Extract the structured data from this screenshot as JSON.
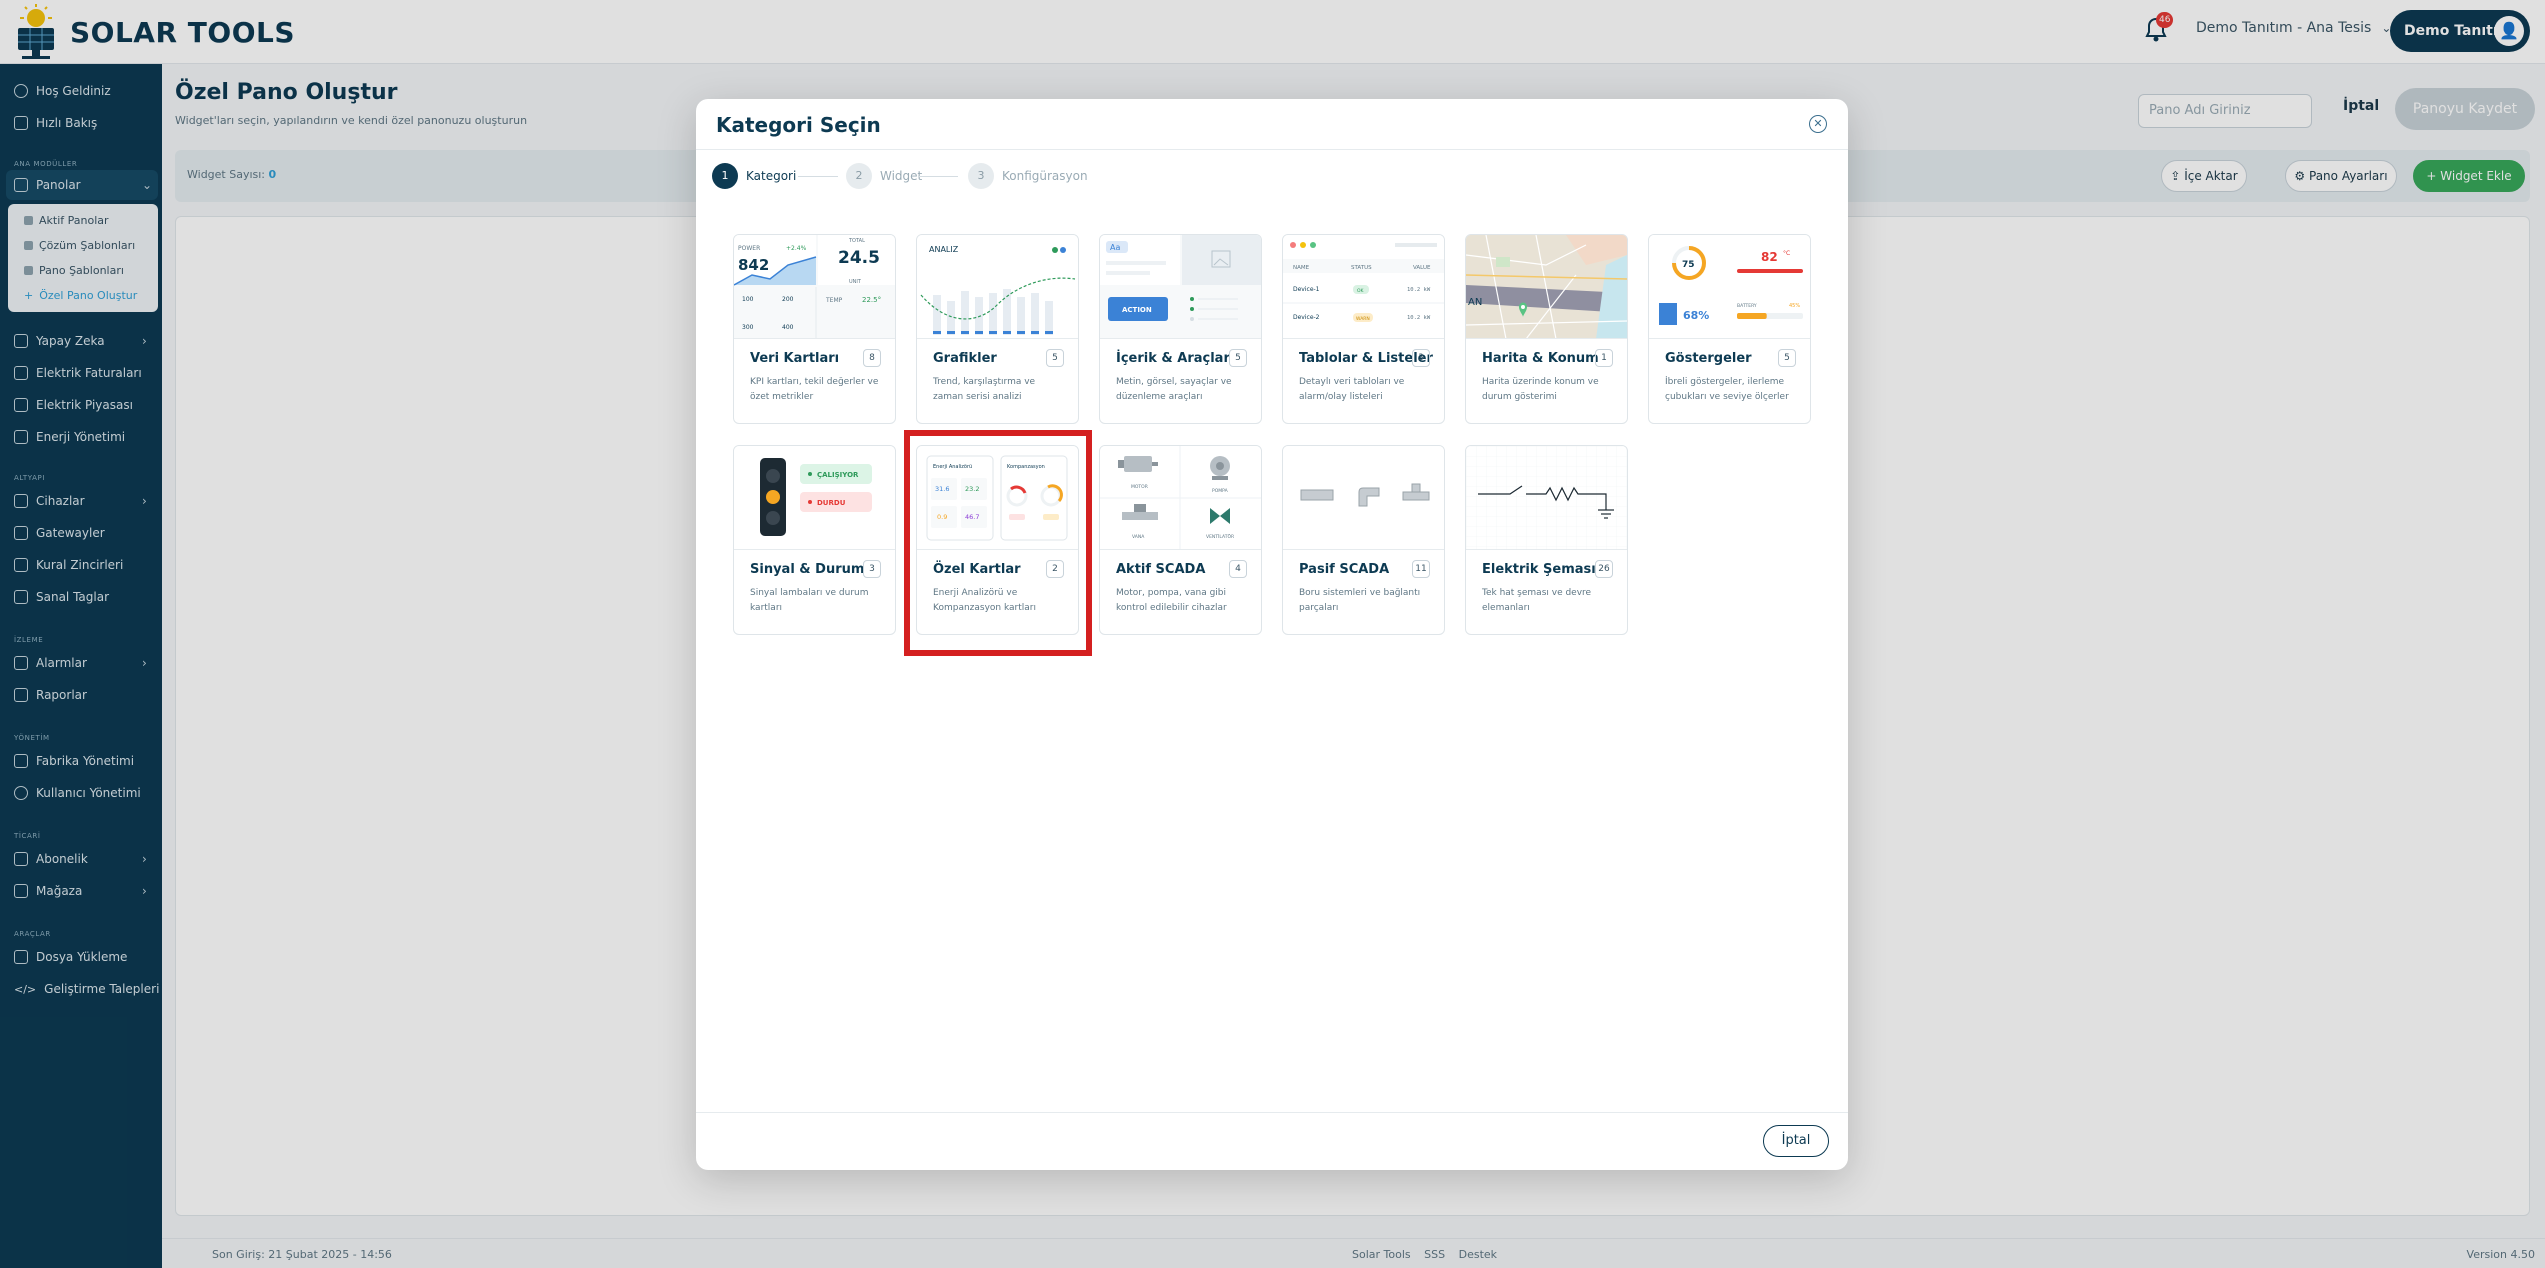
{
  "header": {
    "brand": "SOLAR TOOLS",
    "notification_count": "46",
    "facility": "Demo Tanıtım - Ana Tesis",
    "user": "Demo Tanıtım"
  },
  "sidebar": {
    "top_items": [
      "Hoş Geldiniz",
      "Hızlı Bakış"
    ],
    "section_main": "ANA MODÜLLER",
    "panolar": "Panolar",
    "panolar_sub": [
      "Aktif Panolar",
      "Çözüm Şablonları",
      "Pano Şablonları",
      "Özel Pano Oluştur"
    ],
    "main_items": [
      "Yapay Zeka",
      "Elektrik Faturaları",
      "Elektrik Piyasası",
      "Enerji Yönetimi"
    ],
    "section_infra": "ALTYAPI",
    "infra_items": [
      "Cihazlar",
      "Gatewayler",
      "Kural Zincirleri",
      "Sanal Taglar"
    ],
    "section_monitor": "İZLEME",
    "monitor_items": [
      "Alarmlar",
      "Raporlar"
    ],
    "section_admin": "YÖNETİM",
    "admin_items": [
      "Fabrika Yönetimi",
      "Kullanıcı Yönetimi"
    ],
    "section_commerce": "TİCARİ",
    "commerce_items": [
      "Abonelik",
      "Mağaza"
    ],
    "section_tools": "ARAÇLAR",
    "tools_items": [
      "Dosya Yükleme",
      "Geliştirme Talepleri"
    ]
  },
  "page": {
    "title": "Özel Pano Oluştur",
    "subtitle": "Widget'ları seçin, yapılandırın ve kendi özel panonuzu oluşturun",
    "name_placeholder": "Pano Adı Giriniz",
    "cancel": "İptal",
    "save": "Panoyu Kaydet",
    "widget_count_label": "Widget Sayısı:",
    "widget_count": "0",
    "import": "İçe Aktar",
    "settings": "Pano Ayarları",
    "add_widget": "Widget Ekle"
  },
  "footer": {
    "last_login": "Son Giriş: 21 Şubat 2025 - 14:56",
    "links": [
      "Solar Tools",
      "SSS",
      "Destek"
    ],
    "version": "Version 4.50"
  },
  "modal": {
    "title": "Kategori Seçin",
    "steps": [
      "Kategori",
      "Widget",
      "Konfigürasyon"
    ],
    "cancel": "İptal",
    "cards": [
      {
        "name": "Veri Kartları",
        "count": "8",
        "desc": "KPI kartları, tekil değerler ve özet metrikler"
      },
      {
        "name": "Grafikler",
        "count": "5",
        "desc": "Trend, karşılaştırma ve zaman serisi analizi"
      },
      {
        "name": "İçerik & Araçlar",
        "count": "5",
        "desc": "Metin, görsel, sayaçlar ve düzenleme araçları"
      },
      {
        "name": "Tablolar & Listeler",
        "count": "3",
        "desc": "Detaylı veri tabloları ve alarm/olay listeleri"
      },
      {
        "name": "Harita & Konum",
        "count": "1",
        "desc": "Harita üzerinde konum ve durum gösterimi"
      },
      {
        "name": "Göstergeler",
        "count": "5",
        "desc": "İbreli göstergeler, ilerleme çubukları ve seviye ölçerler"
      },
      {
        "name": "Sinyal & Durum",
        "count": "3",
        "desc": "Sinyal lambaları ve durum kartları"
      },
      {
        "name": "Özel Kartlar",
        "count": "2",
        "desc": "Enerji Analizörü ve Kompanzasyon kartları"
      },
      {
        "name": "Aktif SCADA",
        "count": "4",
        "desc": "Motor, pompa, vana gibi kontrol edilebilir cihazlar"
      },
      {
        "name": "Pasif SCADA",
        "count": "11",
        "desc": "Boru sistemleri ve bağlantı parçaları"
      },
      {
        "name": "Elektrik Şeması",
        "count": "26",
        "desc": "Tek hat şeması ve devre elemanları"
      }
    ],
    "previews": {
      "data_cards": {
        "power_label": "POWER",
        "power_value": "842",
        "delta": "+2.4%",
        "total_label": "TOTAL",
        "big_value": "24.5",
        "unit": "UNIT",
        "temp_label": "TEMP",
        "temp_value": "22.5°",
        "mini": [
          "100",
          "200",
          "300",
          "400"
        ]
      },
      "charts": {
        "label": "ANALIZ"
      },
      "content": {
        "tag": "Aa",
        "action": "ACTION"
      },
      "tables": {
        "headers": [
          "NAME",
          "STATUS",
          "VALUE"
        ],
        "rows": [
          {
            "name": "Device-1",
            "status": "OK",
            "value": "10.2 kW"
          },
          {
            "name": "Device-2",
            "status": "WARN",
            "value": "10.2 kW"
          }
        ]
      },
      "gauges": {
        "gauge_value": "75",
        "temp_value": "82",
        "temp_unit": "°C",
        "fill_label": "68%",
        "progress_label": "BATTERY",
        "progress_value": "45%"
      },
      "signal": {
        "running": "ÇALIŞIYOR",
        "stopped": "DURDU"
      },
      "special": {
        "card1_title": "Enerji Analizörü",
        "card2_title": "Kompanzasyon",
        "values": [
          "31.6",
          "23.2",
          "0.9",
          "46.7"
        ]
      },
      "scada": {
        "labels": [
          "MOTOR",
          "POMPA",
          "VANA",
          "VENTİLATÖR"
        ]
      },
      "map": {
        "label": "AN"
      }
    }
  }
}
